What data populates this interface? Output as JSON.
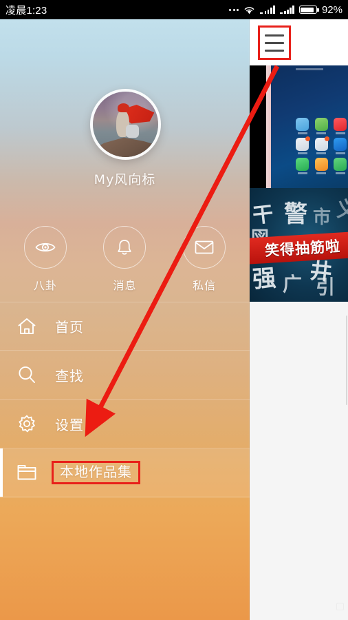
{
  "status_bar": {
    "clock": "凌晨1:23",
    "battery_pct": "92%",
    "icons": [
      "more-dots-icon",
      "wifi-icon",
      "signal-icon",
      "signal-icon",
      "battery-icon"
    ]
  },
  "drawer": {
    "username": "My风向标",
    "avatar_alt": "user-avatar",
    "shortcuts": [
      {
        "label": "八卦",
        "icon": "eye-icon"
      },
      {
        "label": "消息",
        "icon": "bell-icon"
      },
      {
        "label": "私信",
        "icon": "envelope-icon"
      }
    ],
    "menu": [
      {
        "label": "首页",
        "icon": "home-icon",
        "selected": false
      },
      {
        "label": "查找",
        "icon": "search-icon",
        "selected": false
      },
      {
        "label": "设置",
        "icon": "gear-icon",
        "selected": false
      },
      {
        "label": "本地作品集",
        "icon": "folder-icon",
        "selected": true
      }
    ]
  },
  "right_panel": {
    "hamburger": "hamburger-menu-icon",
    "thumbnails": [
      {
        "name": "phone-home-screen-thumbnail",
        "caption": ""
      },
      {
        "name": "video-thumbnail",
        "caption": "笑得抽筋啦"
      }
    ]
  },
  "annotation": {
    "color": "#e8201a",
    "arrow": "points from hamburger menu to 本地作品集",
    "highlight_boxes": [
      "hamburger-menu-icon",
      "本地作品集"
    ]
  },
  "colors": {
    "gradient_top": "#c2e0ec",
    "gradient_mid": "#d8b58f",
    "gradient_bottom": "#eb9849",
    "selected_row": "#e8a055",
    "annotation_red": "#e8201a",
    "status_bar_bg": "#000000",
    "banner_red": "#d4211a"
  }
}
